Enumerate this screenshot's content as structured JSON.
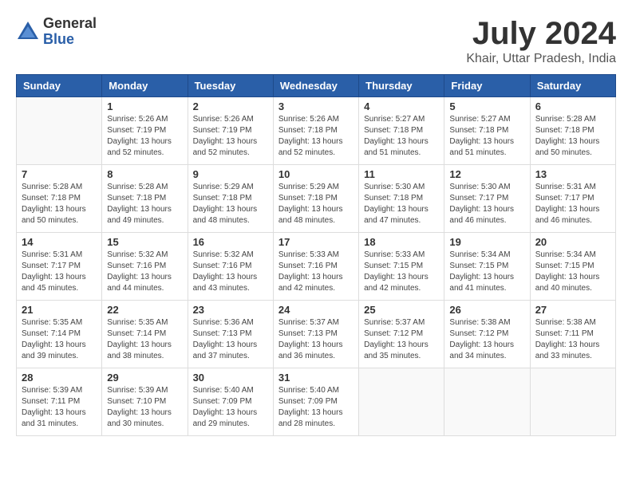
{
  "logo": {
    "general": "General",
    "blue": "Blue"
  },
  "header": {
    "title": "July 2024",
    "subtitle": "Khair, Uttar Pradesh, India"
  },
  "calendar": {
    "columns": [
      "Sunday",
      "Monday",
      "Tuesday",
      "Wednesday",
      "Thursday",
      "Friday",
      "Saturday"
    ],
    "weeks": [
      [
        {
          "day": "",
          "info": ""
        },
        {
          "day": "1",
          "info": "Sunrise: 5:26 AM\nSunset: 7:19 PM\nDaylight: 13 hours\nand 52 minutes."
        },
        {
          "day": "2",
          "info": "Sunrise: 5:26 AM\nSunset: 7:19 PM\nDaylight: 13 hours\nand 52 minutes."
        },
        {
          "day": "3",
          "info": "Sunrise: 5:26 AM\nSunset: 7:18 PM\nDaylight: 13 hours\nand 52 minutes."
        },
        {
          "day": "4",
          "info": "Sunrise: 5:27 AM\nSunset: 7:18 PM\nDaylight: 13 hours\nand 51 minutes."
        },
        {
          "day": "5",
          "info": "Sunrise: 5:27 AM\nSunset: 7:18 PM\nDaylight: 13 hours\nand 51 minutes."
        },
        {
          "day": "6",
          "info": "Sunrise: 5:28 AM\nSunset: 7:18 PM\nDaylight: 13 hours\nand 50 minutes."
        }
      ],
      [
        {
          "day": "7",
          "info": "Sunrise: 5:28 AM\nSunset: 7:18 PM\nDaylight: 13 hours\nand 50 minutes."
        },
        {
          "day": "8",
          "info": "Sunrise: 5:28 AM\nSunset: 7:18 PM\nDaylight: 13 hours\nand 49 minutes."
        },
        {
          "day": "9",
          "info": "Sunrise: 5:29 AM\nSunset: 7:18 PM\nDaylight: 13 hours\nand 48 minutes."
        },
        {
          "day": "10",
          "info": "Sunrise: 5:29 AM\nSunset: 7:18 PM\nDaylight: 13 hours\nand 48 minutes."
        },
        {
          "day": "11",
          "info": "Sunrise: 5:30 AM\nSunset: 7:18 PM\nDaylight: 13 hours\nand 47 minutes."
        },
        {
          "day": "12",
          "info": "Sunrise: 5:30 AM\nSunset: 7:17 PM\nDaylight: 13 hours\nand 46 minutes."
        },
        {
          "day": "13",
          "info": "Sunrise: 5:31 AM\nSunset: 7:17 PM\nDaylight: 13 hours\nand 46 minutes."
        }
      ],
      [
        {
          "day": "14",
          "info": "Sunrise: 5:31 AM\nSunset: 7:17 PM\nDaylight: 13 hours\nand 45 minutes."
        },
        {
          "day": "15",
          "info": "Sunrise: 5:32 AM\nSunset: 7:16 PM\nDaylight: 13 hours\nand 44 minutes."
        },
        {
          "day": "16",
          "info": "Sunrise: 5:32 AM\nSunset: 7:16 PM\nDaylight: 13 hours\nand 43 minutes."
        },
        {
          "day": "17",
          "info": "Sunrise: 5:33 AM\nSunset: 7:16 PM\nDaylight: 13 hours\nand 42 minutes."
        },
        {
          "day": "18",
          "info": "Sunrise: 5:33 AM\nSunset: 7:15 PM\nDaylight: 13 hours\nand 42 minutes."
        },
        {
          "day": "19",
          "info": "Sunrise: 5:34 AM\nSunset: 7:15 PM\nDaylight: 13 hours\nand 41 minutes."
        },
        {
          "day": "20",
          "info": "Sunrise: 5:34 AM\nSunset: 7:15 PM\nDaylight: 13 hours\nand 40 minutes."
        }
      ],
      [
        {
          "day": "21",
          "info": "Sunrise: 5:35 AM\nSunset: 7:14 PM\nDaylight: 13 hours\nand 39 minutes."
        },
        {
          "day": "22",
          "info": "Sunrise: 5:35 AM\nSunset: 7:14 PM\nDaylight: 13 hours\nand 38 minutes."
        },
        {
          "day": "23",
          "info": "Sunrise: 5:36 AM\nSunset: 7:13 PM\nDaylight: 13 hours\nand 37 minutes."
        },
        {
          "day": "24",
          "info": "Sunrise: 5:37 AM\nSunset: 7:13 PM\nDaylight: 13 hours\nand 36 minutes."
        },
        {
          "day": "25",
          "info": "Sunrise: 5:37 AM\nSunset: 7:12 PM\nDaylight: 13 hours\nand 35 minutes."
        },
        {
          "day": "26",
          "info": "Sunrise: 5:38 AM\nSunset: 7:12 PM\nDaylight: 13 hours\nand 34 minutes."
        },
        {
          "day": "27",
          "info": "Sunrise: 5:38 AM\nSunset: 7:11 PM\nDaylight: 13 hours\nand 33 minutes."
        }
      ],
      [
        {
          "day": "28",
          "info": "Sunrise: 5:39 AM\nSunset: 7:11 PM\nDaylight: 13 hours\nand 31 minutes."
        },
        {
          "day": "29",
          "info": "Sunrise: 5:39 AM\nSunset: 7:10 PM\nDaylight: 13 hours\nand 30 minutes."
        },
        {
          "day": "30",
          "info": "Sunrise: 5:40 AM\nSunset: 7:09 PM\nDaylight: 13 hours\nand 29 minutes."
        },
        {
          "day": "31",
          "info": "Sunrise: 5:40 AM\nSunset: 7:09 PM\nDaylight: 13 hours\nand 28 minutes."
        },
        {
          "day": "",
          "info": ""
        },
        {
          "day": "",
          "info": ""
        },
        {
          "day": "",
          "info": ""
        }
      ]
    ]
  }
}
